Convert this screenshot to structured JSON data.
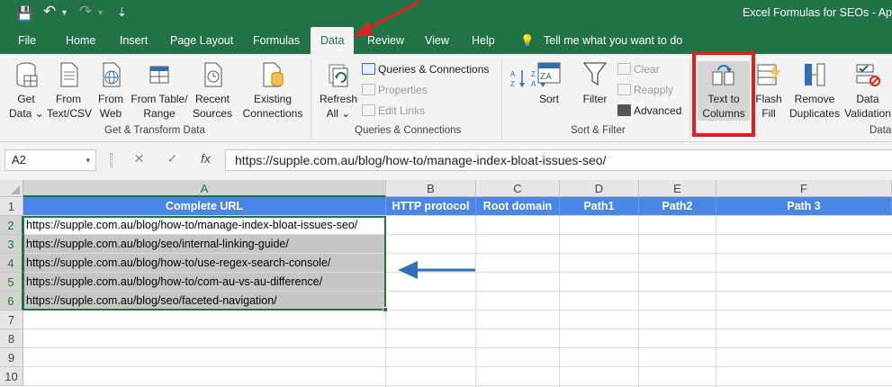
{
  "quick_access": {
    "save": "💾",
    "undo": "↶",
    "undo_dd": "▾",
    "redo": "↷",
    "redo_dd": "▾",
    "customize": "⇣"
  },
  "window": {
    "title": "Excel Formulas for SEOs - Ap"
  },
  "tabs": [
    "File",
    "Home",
    "Insert",
    "Page Layout",
    "Formulas",
    "Data",
    "Review",
    "View",
    "Help"
  ],
  "active_tab": "Data",
  "tell_me": {
    "icon": "lightbulb-icon",
    "label": "Tell me what you want to do"
  },
  "ribbon": {
    "get_data": "Get\nData ⌄",
    "from_text_csv": "From\nText/CSV",
    "from_web": "From\nWeb",
    "from_table_range": "From Table/\nRange",
    "recent_sources": "Recent\nSources",
    "existing_connections": "Existing\nConnections",
    "group_get_transform": "Get & Transform Data",
    "refresh_all": "Refresh\nAll ⌄",
    "queries_connections": "Queries & Connections",
    "properties": "Properties",
    "edit_links": "Edit Links",
    "group_queries": "Queries & Connections",
    "sort": "Sort",
    "filter": "Filter",
    "clear": "Clear",
    "reapply": "Reapply",
    "advanced": "Advanced",
    "group_sort_filter": "Sort & Filter",
    "text_to_columns": "Text to\nColumns",
    "flash_fill": "Flash\nFill",
    "remove_duplicates": "Remove\nDuplicates",
    "data_validation": "Data\nValidation",
    "group_data_tools": "Data"
  },
  "formula_bar": {
    "name_box": "A2",
    "name_box_dd": "▾",
    "cancel_icon": "✕",
    "enter_icon": "✓",
    "fx_icon": "fx",
    "formula": "https://supple.com.au/blog/how-to/manage-index-bloat-issues-seo/"
  },
  "grid": {
    "columns": [
      "A",
      "B",
      "C",
      "D",
      "E",
      "F"
    ],
    "rows": [
      "1",
      "2",
      "3",
      "4",
      "5",
      "6",
      "7",
      "8",
      "9",
      "10"
    ],
    "header_row": [
      "Complete URL",
      "HTTP protocol",
      "Root domain",
      "Path1",
      "Path2",
      "Path 3"
    ],
    "urls": [
      "https://supple.com.au/blog/how-to/manage-index-bloat-issues-seo/",
      "https://supple.com.au/blog/seo/internal-linking-guide/",
      "https://supple.com.au/blog/how-to/use-regex-search-console/",
      "https://supple.com.au/blog/how-to/com-au-vs-au-difference/",
      "https://supple.com.au/blog/seo/faceted-navigation/"
    ]
  },
  "colors": {
    "excel_green": "#217346",
    "header_blue": "#4a86e8",
    "highlight_red": "#e02020",
    "arrow_blue": "#2e6fb7"
  }
}
